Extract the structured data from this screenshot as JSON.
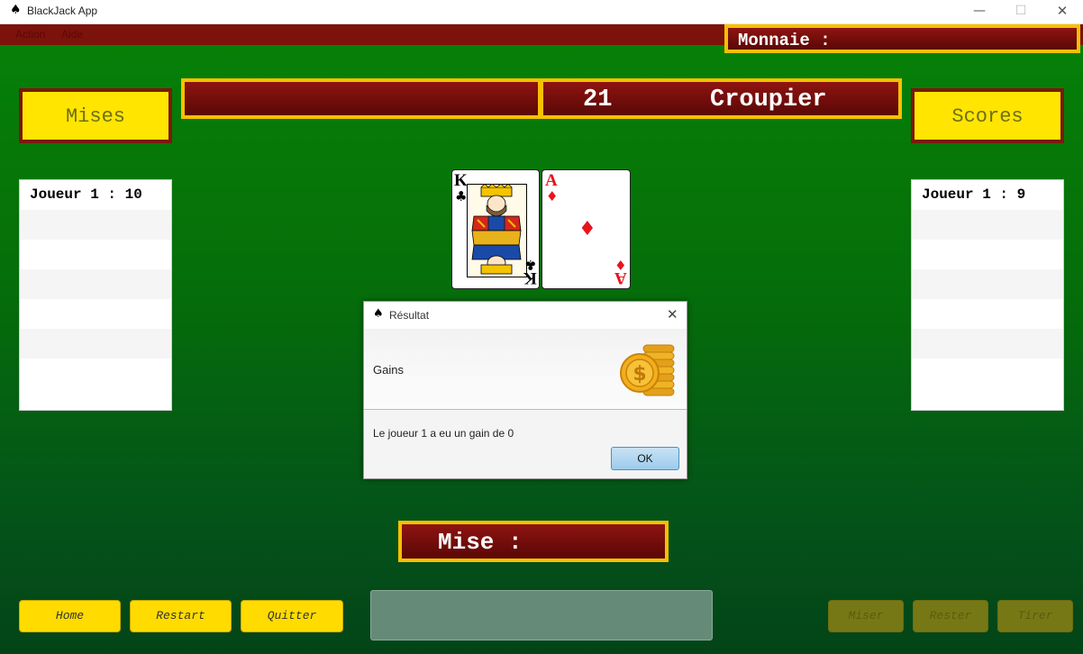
{
  "window": {
    "title": "BlackJack App",
    "app_icon": "spade-icon",
    "controls": {
      "minimize": "—",
      "maximize": "☐",
      "close": "✕"
    }
  },
  "menu": {
    "items": [
      "Action",
      "Aide"
    ]
  },
  "monnaie": {
    "label": "Monnaie :",
    "value": ""
  },
  "mises": {
    "label": "Mises",
    "entries": [
      "Joueur 1 : 10",
      "",
      "",
      "",
      "",
      "",
      "",
      ""
    ]
  },
  "croupier": {
    "score": "21",
    "label": "Croupier"
  },
  "scores": {
    "label": "Scores",
    "entries": [
      "Joueur 1 : 9",
      "",
      "",
      "",
      "",
      "",
      "",
      ""
    ]
  },
  "cards": [
    {
      "rank": "K",
      "suit": "♣",
      "color": "#000000",
      "name": "King of Clubs"
    },
    {
      "rank": "A",
      "suit": "♦",
      "color": "#e8141b",
      "name": "Ace of Diamonds"
    }
  ],
  "dialog": {
    "title": "Résultat",
    "header": "Gains",
    "message": "Le joueur 1 a eu un gain de 0",
    "ok_label": "OK",
    "icon": "coins-icon"
  },
  "mise": {
    "label": "Mise :",
    "value": ""
  },
  "buttons": {
    "home": "Home",
    "restart": "Restart",
    "quitter": "Quitter",
    "miser": "Miser",
    "rester": "Rester",
    "tirer": "Tirer"
  },
  "colors": {
    "table_green": "#078107",
    "panel_red": "#7a0c0b",
    "gold_border": "#f7c000",
    "button_yellow": "#ffdb00"
  }
}
